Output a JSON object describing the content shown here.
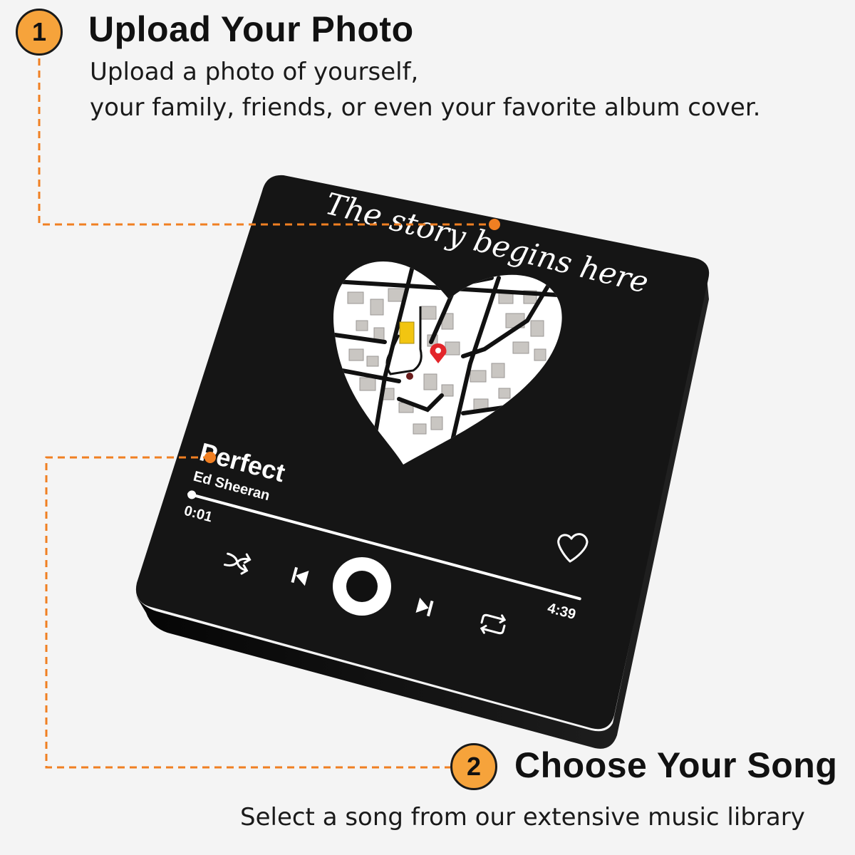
{
  "step1": {
    "number": "1",
    "title": "Upload Your Photo",
    "desc_line1": "Upload a photo of yourself,",
    "desc_line2": "your family, friends, or even your favorite album cover."
  },
  "step2": {
    "number": "2",
    "title": "Choose Your Song",
    "desc": "Select a song from our extensive music library"
  },
  "plaque": {
    "caption": "The story begins here",
    "song_title": "Perfect",
    "artist": "Ed Sheeran",
    "elapsed": "0:01",
    "duration": "4:39",
    "progress_fraction": 0.004
  },
  "colors": {
    "accent": "#f6a33b",
    "plaque": "#141414",
    "map_pin": "#e3262b",
    "map_highlight": "#f2c511"
  },
  "icons": [
    "shuffle-icon",
    "previous-icon",
    "play-button",
    "next-icon",
    "repeat-icon",
    "heart-icon",
    "map-pin-icon"
  ]
}
